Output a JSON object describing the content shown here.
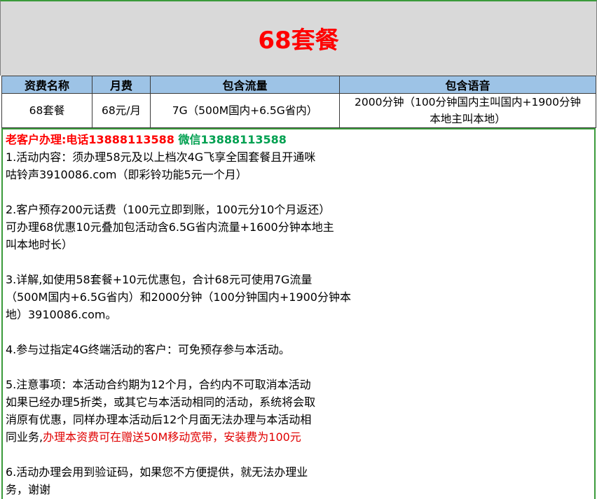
{
  "title": "68套餐",
  "table": {
    "headers": [
      "资费名称",
      "月费",
      "包含流量",
      "包含语音"
    ],
    "row": {
      "name": "68套餐",
      "fee": "68元/月",
      "data": "7G（500M国内+6.5G省内）",
      "voice_line1": "2000分钟（100分钟国内主叫国内+1900分钟",
      "voice_line2": "本地主叫本地）"
    }
  },
  "contact": {
    "label": "老客户办理:电话13888113588",
    "wechat": "微信13888113588"
  },
  "notes": {
    "p1": [
      "1.活动内容：须办理58元及以上档次4G飞享全国套餐且开通咪",
      "咕铃声3910086.com（即彩铃功能5元一个月）"
    ],
    "p2": [
      "2.客户预存200元话费（100元立即到账，100元分10个月返还）",
      "可办理68优惠10元叠加包活动含6.5G省内流量+1600分钟本地主",
      "叫本地时长）"
    ],
    "p3": [
      "3.详解,如使用58套餐+10元优惠包，合计68元可使用7G流量",
      "（500M国内+6.5G省内）和2000分钟（100分钟国内+1900分钟本",
      "地）3910086.com。"
    ],
    "p4": [
      "4.参与过指定4G终端活动的客户：可免预存参与本活动。"
    ],
    "p5": [
      "5.注意事项：本活动合约期为12个月，合约内不可取消本活动",
      "如果已经办理5折类，或其它与本活动相同的活动，系统将会取",
      "消原有优惠，同样办理本活动后12个月面无法办理与本活动相"
    ],
    "p5_last_prefix": "同业务,",
    "p5_last_red": "办理本资费可在赠送50M移动宽带，安装费为100元",
    "p6": [
      "6.活动办理会用到验证码，如果您不方便提供，就无法办理业",
      "务，谢谢"
    ]
  },
  "colors": {
    "title": "#ff0000",
    "header_bg": "#9dc3e6",
    "title_band_bg": "#d9d9d9",
    "frame_border": "#3a9a3a",
    "wechat": "#00a050",
    "highlight": "#e00000"
  }
}
